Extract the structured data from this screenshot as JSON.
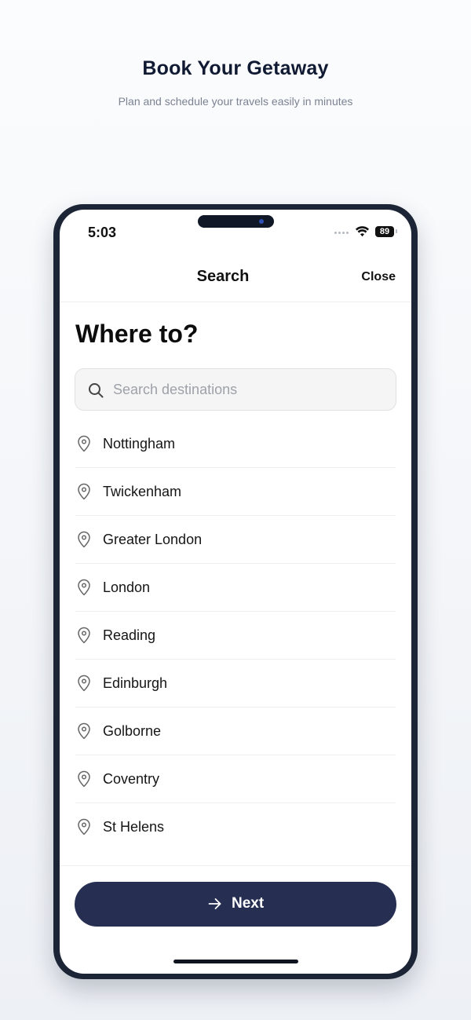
{
  "hero": {
    "title": "Book Your Getaway",
    "subtitle": "Plan and schedule your travels easily in minutes"
  },
  "status_bar": {
    "time": "5:03",
    "battery": "89"
  },
  "nav": {
    "title": "Search",
    "close_label": "Close"
  },
  "heading": "Where to?",
  "search": {
    "placeholder": "Search destinations",
    "value": ""
  },
  "destinations": [
    {
      "label": "Nottingham"
    },
    {
      "label": "Twickenham"
    },
    {
      "label": "Greater London"
    },
    {
      "label": "London"
    },
    {
      "label": "Reading"
    },
    {
      "label": "Edinburgh"
    },
    {
      "label": "Golborne"
    },
    {
      "label": "Coventry"
    },
    {
      "label": "St Helens"
    }
  ],
  "footer": {
    "next_label": "Next"
  },
  "icons": {
    "search": "search-icon",
    "pin": "map-pin-icon",
    "next": "arrow-right-icon",
    "wifi": "wifi-icon",
    "battery": "battery-icon"
  },
  "colors": {
    "primary_button": "#262f52",
    "phone_frame": "#1c2536",
    "hero_title": "#111a33"
  }
}
